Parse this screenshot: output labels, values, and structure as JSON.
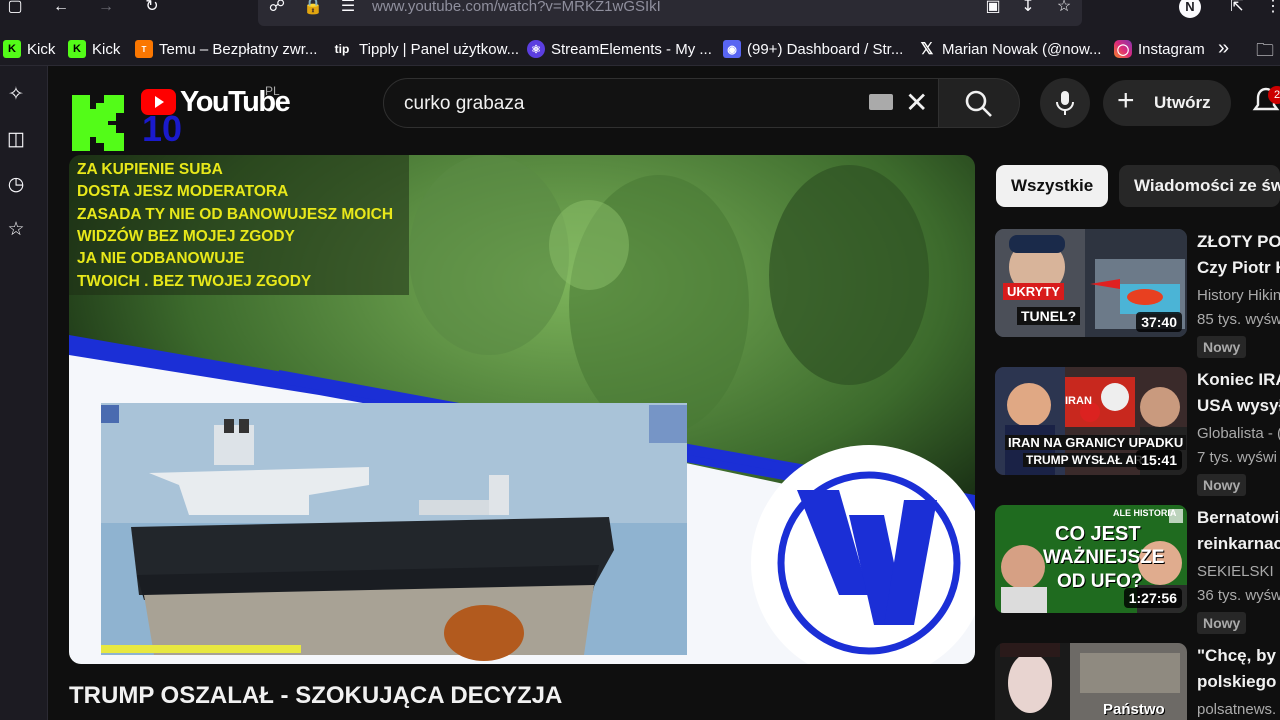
{
  "browser": {
    "url": "www.youtube.com/watch?v=MRKZ1wGSIkI",
    "bookmarks": [
      {
        "label": "Kick",
        "icon": "kick-icon"
      },
      {
        "label": "Kick",
        "icon": "kick-icon"
      },
      {
        "label": "Temu – Bezpłatny zwr...",
        "icon": "temu-icon"
      },
      {
        "label": "Tipply | Panel użytkow...",
        "icon": "tipply-icon"
      },
      {
        "label": "StreamElements - My ...",
        "icon": "streamelements-icon"
      },
      {
        "label": "(99+) Dashboard / Str...",
        "icon": "discord-icon"
      },
      {
        "label": "Marian Nowak (@now...",
        "icon": "x-icon"
      },
      {
        "label": "Instagram",
        "icon": "instagram-icon"
      }
    ],
    "profile_initial": "N"
  },
  "youtube": {
    "logo_text": "YouTube",
    "region": "PL",
    "search_query": "curko grabaza",
    "create_label": "Utwórz",
    "notif_count": "2",
    "overlay_logo_text": "10",
    "player_overlay_lines": [
      "ZA KUPIENIE SUBA",
      "DOSTA JESZ MODERATORA",
      "ZASADA  TY NIE OD BANOWUJESZ MOICH",
      "WIDZÓW BEZ MOJEJ ZGODY",
      "JA NIE ODBANOWUJE",
      "TWOICH . BEZ TWOJEJ ZGODY"
    ],
    "video_title": "TRUMP OSZALAŁ - SZOKUJĄCA DECYZJA",
    "chips": [
      "Wszystkie",
      "Wiadomości ze św"
    ],
    "related": [
      {
        "title1": "ZŁOTY PO",
        "title2": "Czy Piotr K",
        "channel": "History Hikin",
        "meta": "85 tys. wyśw",
        "badge": "Nowy",
        "duration": "37:40",
        "thumb_text1": "UKRYTY",
        "thumb_text2": "TUNEL?"
      },
      {
        "title1": "Koniec IRA",
        "title2": "USA wysył",
        "channel": "Globalista - (",
        "meta": "7 tys. wyświ",
        "badge": "Nowy",
        "duration": "15:41",
        "thumb_text1": "IRAN NA GRANICY UPADKU",
        "thumb_text2": "TRUMP WYSŁAŁ AR",
        "thumb_text3": "IRAN"
      },
      {
        "title1": "Bernatowic",
        "title2": "reinkarnac",
        "channel": "SEKIELSKI",
        "meta": "36 tys. wyśw",
        "badge": "Nowy",
        "duration": "1:27:56",
        "thumb_text1": "CO JEST",
        "thumb_text2": "WAŻNIEJSZE",
        "thumb_text3": "OD UFO?",
        "thumb_text4": "ALE HISTORIA"
      },
      {
        "title1": "\"Chcę, by t",
        "title2": "polskiego",
        "channel": "polsatnews.",
        "thumb_text1": "Państwo"
      }
    ]
  },
  "colors": {
    "overlay_text": "#e8e81a",
    "kick_green": "#53fc18",
    "youtube_red": "#ff0000"
  }
}
